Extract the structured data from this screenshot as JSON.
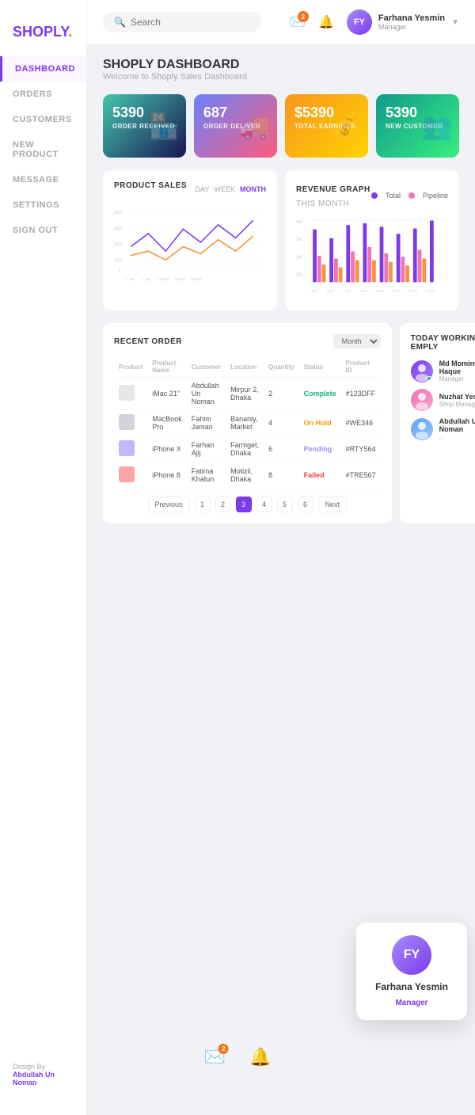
{
  "app": {
    "name": "SHOPLY",
    "dot": "."
  },
  "sidebar": {
    "items": [
      {
        "label": "DASHBOARD",
        "active": true
      },
      {
        "label": "ORDERS",
        "active": false
      },
      {
        "label": "CUSTOMERS",
        "active": false
      },
      {
        "label": "NEW PRODUCT",
        "active": false
      },
      {
        "label": "MESSAGE",
        "active": false
      },
      {
        "label": "SETTINGS",
        "active": false
      },
      {
        "label": "SIGN OUT",
        "active": false
      }
    ],
    "design_by": "Design By",
    "designer": "Abdullah Un Noman"
  },
  "header": {
    "search_placeholder": "Search",
    "mail_badge": "2",
    "notif_badge": "",
    "user_name": "Farhana  Yesmin",
    "user_role": "Manager"
  },
  "dashboard": {
    "title": "SHOPLY DASHBOARD",
    "subtitle": "Welcome to Shoply Sales Dashboard",
    "stats": [
      {
        "value": "5390",
        "label": "ORDER RECEIVED",
        "icon": "🏪"
      },
      {
        "value": "687",
        "label": "ORDER DELIVER",
        "icon": "🚚"
      },
      {
        "value": "$5390",
        "label": "TOTAL EARNINGS",
        "icon": "💰"
      },
      {
        "value": "5390",
        "label": "NEW CUSTOMER",
        "icon": "👥"
      }
    ]
  },
  "product_sales": {
    "title": "PRODUCT SALES",
    "tabs": [
      "DAY",
      "WEEK",
      "MONTH"
    ],
    "active_tab": "MONTH",
    "y_labels": [
      "4000",
      "3000",
      "2000",
      "1000",
      "0"
    ],
    "x_labels": [
      "1 April",
      "7 April",
      "14 April",
      "21 April",
      "29 April"
    ]
  },
  "revenue_graph": {
    "title": "REVENUE GRAPH",
    "subtitle": "THIS MONTH",
    "legend": [
      "Total",
      "Pipeline"
    ],
    "y_labels": [
      "40k",
      "30k",
      "20k",
      "10k"
    ],
    "x_labels": [
      "1 April",
      "3 April",
      "6 April",
      "9April",
      "13 April",
      "17 April",
      "23 April",
      "30 April"
    ],
    "bars": [
      {
        "purple": 70,
        "pink": 30,
        "orange": 20
      },
      {
        "purple": 50,
        "pink": 25,
        "orange": 18
      },
      {
        "purple": 80,
        "pink": 35,
        "orange": 25
      },
      {
        "purple": 85,
        "pink": 40,
        "orange": 20
      },
      {
        "purple": 75,
        "pink": 30,
        "orange": 22
      },
      {
        "purple": 60,
        "pink": 28,
        "orange": 18
      },
      {
        "purple": 78,
        "pink": 32,
        "orange": 20
      },
      {
        "purple": 90,
        "pink": 0,
        "orange": 0
      }
    ]
  },
  "recent_orders": {
    "title": "RECENT ORDER",
    "filter": "Month",
    "columns": [
      "Product",
      "Product Name",
      "Customer",
      "Location",
      "Quantity",
      "Status",
      "Product ID"
    ],
    "rows": [
      {
        "img_bg": "#e5e7eb",
        "product": "iMac 21\"",
        "customer": "Abdullah Un Noman",
        "location": "Mirpur 2, Dhaka",
        "quantity": "2",
        "status": "Complete",
        "status_class": "status-complete",
        "product_id": "#123DFF"
      },
      {
        "img_bg": "#d1d5db",
        "product": "MacBook Pro",
        "customer": "Fahim Jaman",
        "location": "Bananiy, Market",
        "quantity": "4",
        "status": "On Hold",
        "status_class": "status-onhold",
        "product_id": "#WE346"
      },
      {
        "img_bg": "#c4b5fd",
        "product": "iPhone X",
        "customer": "Farhan Ajij",
        "location": "Farmget, Dhaka",
        "quantity": "6",
        "status": "Pending",
        "status_class": "status-pending",
        "product_id": "#RTY564"
      },
      {
        "img_bg": "#fca5a5",
        "product": "iPhone 8",
        "customer": "Fatima Khatun",
        "location": "Motizil, Dhaka",
        "quantity": "8",
        "status": "Failed",
        "status_class": "status-failed",
        "product_id": "#TRE567"
      }
    ],
    "pagination": {
      "prev": "Previous",
      "pages": [
        "1",
        "2",
        "3",
        "4",
        "5",
        "6"
      ],
      "active_page": "3",
      "next": "Next"
    }
  },
  "working_employees": {
    "title": "TODAY WORKING EMPLY",
    "employees": [
      {
        "name": "Md Mominul Haque",
        "role": "Manager",
        "online": true,
        "color": "#7c3aed"
      },
      {
        "name": "Nuzhat Yesmin",
        "role": "Shop Manager",
        "online": false,
        "color": "#f472b6"
      },
      {
        "name": "Abdullah Un Noman",
        "role": "...",
        "online": false,
        "color": "#60a5fa"
      }
    ]
  },
  "profile_popup": {
    "name": "Farhana  Yesmin",
    "role": "Manager"
  },
  "bottom_bar": {
    "mail_badge": "2"
  }
}
